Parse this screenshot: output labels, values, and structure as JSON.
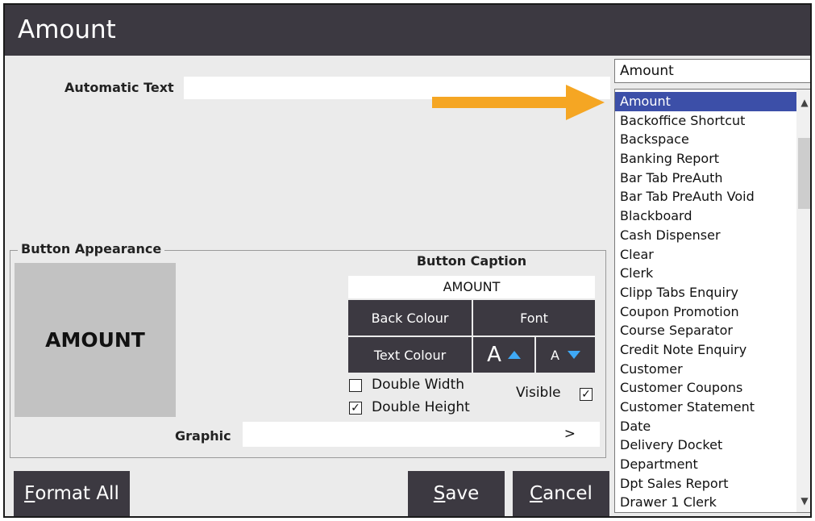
{
  "window": {
    "title": "Amount"
  },
  "automatic_text": {
    "label": "Automatic Text",
    "value": ""
  },
  "function_combo": {
    "value": "Amount"
  },
  "function_list": {
    "selected": "Amount",
    "items": [
      "Amount",
      "Backoffice Shortcut",
      "Backspace",
      "Banking Report",
      "Bar Tab PreAuth",
      "Bar Tab PreAuth Void",
      "Blackboard",
      "Cash Dispenser",
      "Clear",
      "Clerk",
      "Clipp Tabs Enquiry",
      "Coupon Promotion",
      "Course Separator",
      "Credit Note Enquiry",
      "Customer",
      "Customer Coupons",
      "Customer Statement",
      "Date",
      "Delivery Docket",
      "Department",
      "Dpt Sales Report",
      "Drawer 1 Clerk"
    ]
  },
  "appearance": {
    "legend": "Button Appearance",
    "preview_text": "AMOUNT",
    "caption_title": "Button Caption",
    "caption_value": "AMOUNT",
    "back_colour": "Back Colour",
    "font": "Font",
    "text_colour": "Text Colour",
    "font_increase_glyph": "A",
    "font_decrease_glyph": "A",
    "double_width": {
      "label": "Double Width",
      "checked": false
    },
    "double_height": {
      "label": "Double Height",
      "checked": true
    },
    "visible": {
      "label": "Visible",
      "checked": true
    },
    "graphic_label": "Graphic",
    "graphic_browse": ">"
  },
  "buttons": {
    "format_all_first": "F",
    "format_all_rest": "ormat All",
    "save_first": "S",
    "save_rest": "ave",
    "cancel_first": "C",
    "cancel_rest": "ancel"
  },
  "colors": {
    "title_bar": "#3c3941",
    "selection": "#3c4fa8",
    "arrow": "#f5a623",
    "panel": "#ebebeb"
  }
}
